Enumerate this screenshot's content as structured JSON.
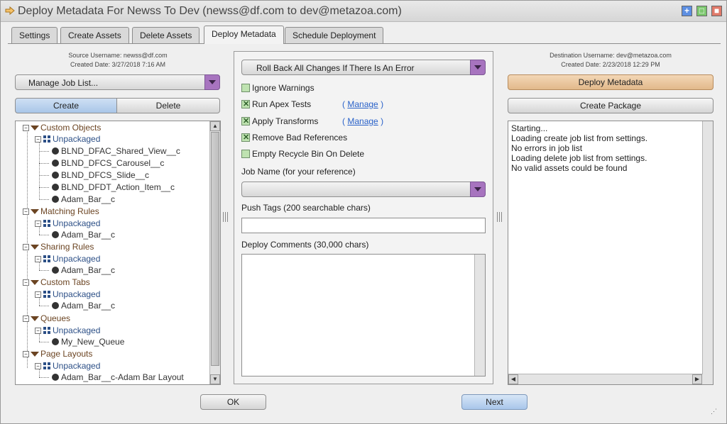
{
  "window": {
    "title": "Deploy Metadata For Newss To Dev (newss@df.com to dev@metazoa.com)"
  },
  "tabs": [
    {
      "label": "Settings"
    },
    {
      "label": "Create Assets"
    },
    {
      "label": "Delete Assets"
    },
    {
      "label": "Deploy Metadata"
    },
    {
      "label": "Schedule Deployment"
    }
  ],
  "active_tab": "Deploy Metadata",
  "source": {
    "username": "Source Username: newss@df.com",
    "created": "Created Date: 3/27/2018 7:16 AM",
    "job_list_select": "Manage Job List...",
    "create_label": "Create",
    "delete_label": "Delete",
    "tree": [
      {
        "category": "Custom Objects",
        "package": "Unpackaged",
        "items": [
          "BLND_DFAC_Shared_View__c",
          "BLND_DFCS_Carousel__c",
          "BLND_DFCS_Slide__c",
          "BLND_DFDT_Action_Item__c",
          "Adam_Bar__c"
        ]
      },
      {
        "category": "Matching Rules",
        "package": "Unpackaged",
        "items": [
          "Adam_Bar__c"
        ]
      },
      {
        "category": "Sharing Rules",
        "package": "Unpackaged",
        "items": [
          "Adam_Bar__c"
        ]
      },
      {
        "category": "Custom Tabs",
        "package": "Unpackaged",
        "items": [
          "Adam_Bar__c"
        ]
      },
      {
        "category": "Queues",
        "package": "Unpackaged",
        "items": [
          "My_New_Queue"
        ]
      },
      {
        "category": "Page Layouts",
        "package": "Unpackaged",
        "items": [
          "Adam_Bar__c-Adam Bar Layout"
        ]
      }
    ]
  },
  "middle": {
    "rollback_select": "Roll Back All Changes If There Is An Error",
    "options": [
      {
        "label": "Ignore Warnings",
        "checked": false
      },
      {
        "label": "Run Apex Tests",
        "checked": true,
        "link": "Manage"
      },
      {
        "label": "Apply Transforms",
        "checked": true,
        "link": "Manage"
      },
      {
        "label": "Remove Bad References",
        "checked": true
      },
      {
        "label": "Empty Recycle Bin On Delete",
        "checked": false
      }
    ],
    "paren_open": "(",
    "paren_close": ")",
    "job_name_label": "Job Name (for your reference)",
    "job_name_value": "",
    "push_tags_label": "Push Tags (200 searchable chars)",
    "push_tags_value": "",
    "comments_label": "Deploy Comments (30,000 chars)",
    "comments_value": ""
  },
  "destination": {
    "username": "Destination Username: dev@metazoa.com",
    "created": "Created Date: 2/23/2018 12:29 PM",
    "deploy_label": "Deploy Metadata",
    "create_package_label": "Create Package",
    "log": [
      "Starting...",
      "Loading create job list from settings.",
      "No errors in job list",
      "Loading delete job list from settings.",
      "No valid assets could be found"
    ]
  },
  "footer": {
    "ok_label": "OK",
    "next_label": "Next"
  },
  "colors": {
    "accent_purple": "#a774bf",
    "deploy_orange": "#e2b98b",
    "tree_category": "#6b4422",
    "tree_package": "#2c4f86"
  }
}
